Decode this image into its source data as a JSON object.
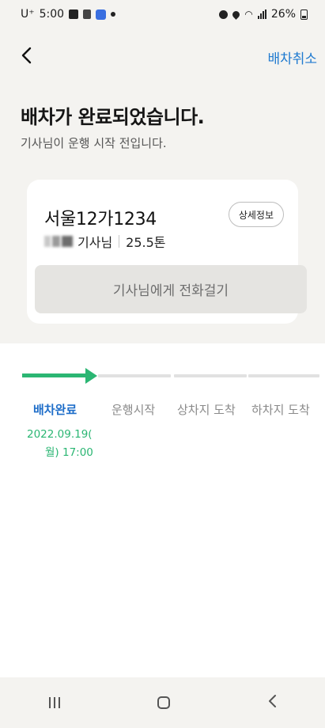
{
  "status_bar": {
    "carrier": "U⁺",
    "time": "5:00",
    "battery": "26%"
  },
  "top_bar": {
    "cancel_label": "배차취소"
  },
  "heading": "배차가 완료되었습니다.",
  "subheading": "기사님이 운행 시작 전입니다.",
  "driver_card": {
    "plate": "서울12가1234",
    "detail_label": "상세정보",
    "driver_suffix": "기사님",
    "tonnage": "25.5톤",
    "call_label": "기사님에게 전화걸기"
  },
  "progress": {
    "completed_steps": 1,
    "steps": [
      {
        "label": "배차완료",
        "date_line1": "2022.09.19(",
        "date_line2": "월) 17:00"
      },
      {
        "label": "운행시작"
      },
      {
        "label": "상차지 도착"
      },
      {
        "label": "하차지 도착"
      }
    ]
  },
  "colors": {
    "accent_blue": "#1f7ad0",
    "progress_green": "#2bb673",
    "background": "#f4f3f0"
  }
}
